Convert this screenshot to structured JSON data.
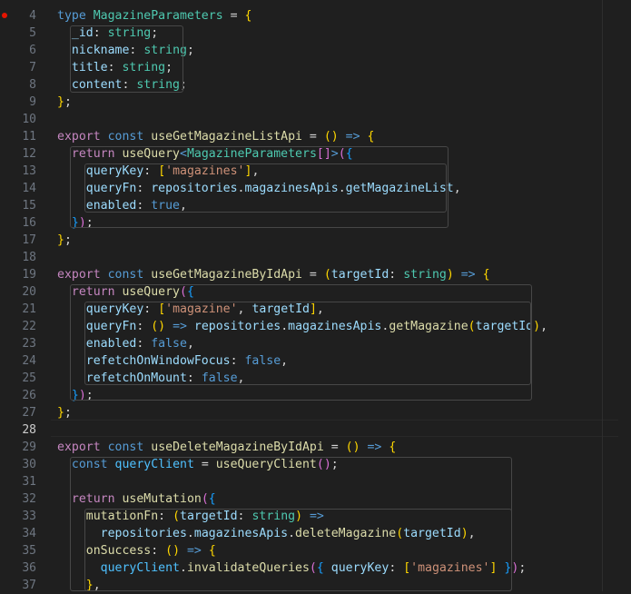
{
  "editor": {
    "language": "typescript",
    "active_line": "28",
    "breakpoint_line": "4",
    "colors": {
      "background": "#1f1f1f",
      "keyword": "#569cd6",
      "control_keyword": "#c586c0",
      "type": "#4ec9b0",
      "function": "#dcdcaa",
      "variable": "#9cdcfe",
      "constant": "#4fc1ff",
      "string": "#ce9178",
      "bracket_level_1": "#ffd700",
      "bracket_level_2": "#da70d6",
      "bracket_level_3": "#179fff",
      "breakpoint": "#e51400"
    }
  },
  "lines": [
    {
      "num": "4",
      "tokens": [
        [
          "type",
          "kw"
        ],
        [
          " ",
          "p"
        ],
        [
          "MagazineParameters",
          "type"
        ],
        [
          " = ",
          "p"
        ],
        [
          "{",
          "b1"
        ]
      ]
    },
    {
      "num": "5",
      "tokens": [
        [
          "  ",
          "p"
        ],
        [
          "_id",
          "var"
        ],
        [
          ": ",
          "p"
        ],
        [
          "string",
          "type"
        ],
        [
          ";",
          "p"
        ]
      ]
    },
    {
      "num": "6",
      "tokens": [
        [
          "  ",
          "p"
        ],
        [
          "nickname",
          "var"
        ],
        [
          ": ",
          "p"
        ],
        [
          "string",
          "type"
        ],
        [
          ";",
          "p"
        ]
      ]
    },
    {
      "num": "7",
      "tokens": [
        [
          "  ",
          "p"
        ],
        [
          "title",
          "var"
        ],
        [
          ": ",
          "p"
        ],
        [
          "string",
          "type"
        ],
        [
          ";",
          "p"
        ]
      ]
    },
    {
      "num": "8",
      "tokens": [
        [
          "  ",
          "p"
        ],
        [
          "content",
          "var"
        ],
        [
          ": ",
          "p"
        ],
        [
          "string",
          "type"
        ],
        [
          ";",
          "p"
        ]
      ]
    },
    {
      "num": "9",
      "tokens": [
        [
          "}",
          "b1"
        ],
        [
          ";",
          "p"
        ]
      ]
    },
    {
      "num": "10",
      "tokens": []
    },
    {
      "num": "11",
      "tokens": [
        [
          "export",
          "ctl"
        ],
        [
          " ",
          "p"
        ],
        [
          "const",
          "kw"
        ],
        [
          " ",
          "p"
        ],
        [
          "useGetMagazineListApi",
          "fn"
        ],
        [
          " = ",
          "p"
        ],
        [
          "()",
          "b1"
        ],
        [
          " ",
          "p"
        ],
        [
          "=>",
          "kw"
        ],
        [
          " ",
          "p"
        ],
        [
          "{",
          "b1"
        ]
      ]
    },
    {
      "num": "12",
      "tokens": [
        [
          "  ",
          "p"
        ],
        [
          "return",
          "ctl"
        ],
        [
          " ",
          "p"
        ],
        [
          "useQuery",
          "fn"
        ],
        [
          "<",
          "kw"
        ],
        [
          "MagazineParameters",
          "type"
        ],
        [
          "[]",
          "b2"
        ],
        [
          ">",
          "kw"
        ],
        [
          "(",
          "b2"
        ],
        [
          "{",
          "b3"
        ]
      ]
    },
    {
      "num": "13",
      "tokens": [
        [
          "    ",
          "p"
        ],
        [
          "queryKey",
          "var"
        ],
        [
          ": ",
          "p"
        ],
        [
          "[",
          "b1"
        ],
        [
          "'magazines'",
          "str"
        ],
        [
          "]",
          "b1"
        ],
        [
          ",",
          "p"
        ]
      ]
    },
    {
      "num": "14",
      "tokens": [
        [
          "    ",
          "p"
        ],
        [
          "queryFn",
          "var"
        ],
        [
          ": ",
          "p"
        ],
        [
          "repositories",
          "var"
        ],
        [
          ".",
          "p"
        ],
        [
          "magazinesApis",
          "var"
        ],
        [
          ".",
          "p"
        ],
        [
          "getMagazineList",
          "var"
        ],
        [
          ",",
          "p"
        ]
      ]
    },
    {
      "num": "15",
      "tokens": [
        [
          "    ",
          "p"
        ],
        [
          "enabled",
          "var"
        ],
        [
          ": ",
          "p"
        ],
        [
          "true",
          "kw"
        ],
        [
          ",",
          "p"
        ]
      ]
    },
    {
      "num": "16",
      "tokens": [
        [
          "  ",
          "p"
        ],
        [
          "}",
          "b3"
        ],
        [
          ")",
          "b2"
        ],
        [
          ";",
          "p"
        ]
      ]
    },
    {
      "num": "17",
      "tokens": [
        [
          "}",
          "b1"
        ],
        [
          ";",
          "p"
        ]
      ]
    },
    {
      "num": "18",
      "tokens": []
    },
    {
      "num": "19",
      "tokens": [
        [
          "export",
          "ctl"
        ],
        [
          " ",
          "p"
        ],
        [
          "const",
          "kw"
        ],
        [
          " ",
          "p"
        ],
        [
          "useGetMagazineByIdApi",
          "fn"
        ],
        [
          " = ",
          "p"
        ],
        [
          "(",
          "b1"
        ],
        [
          "targetId",
          "var"
        ],
        [
          ": ",
          "p"
        ],
        [
          "string",
          "type"
        ],
        [
          ")",
          "b1"
        ],
        [
          " ",
          "p"
        ],
        [
          "=>",
          "kw"
        ],
        [
          " ",
          "p"
        ],
        [
          "{",
          "b1"
        ]
      ]
    },
    {
      "num": "20",
      "tokens": [
        [
          "  ",
          "p"
        ],
        [
          "return",
          "ctl"
        ],
        [
          " ",
          "p"
        ],
        [
          "useQuery",
          "fn"
        ],
        [
          "(",
          "b2"
        ],
        [
          "{",
          "b3"
        ]
      ]
    },
    {
      "num": "21",
      "tokens": [
        [
          "    ",
          "p"
        ],
        [
          "queryKey",
          "var"
        ],
        [
          ": ",
          "p"
        ],
        [
          "[",
          "b1"
        ],
        [
          "'magazine'",
          "str"
        ],
        [
          ", ",
          "p"
        ],
        [
          "targetId",
          "var"
        ],
        [
          "]",
          "b1"
        ],
        [
          ",",
          "p"
        ]
      ]
    },
    {
      "num": "22",
      "tokens": [
        [
          "    ",
          "p"
        ],
        [
          "queryFn",
          "var"
        ],
        [
          ": ",
          "p"
        ],
        [
          "()",
          "b1"
        ],
        [
          " ",
          "p"
        ],
        [
          "=>",
          "kw"
        ],
        [
          " ",
          "p"
        ],
        [
          "repositories",
          "var"
        ],
        [
          ".",
          "p"
        ],
        [
          "magazinesApis",
          "var"
        ],
        [
          ".",
          "p"
        ],
        [
          "getMagazine",
          "fn"
        ],
        [
          "(",
          "b1"
        ],
        [
          "targetId",
          "var"
        ],
        [
          ")",
          "b1"
        ],
        [
          ",",
          "p"
        ]
      ]
    },
    {
      "num": "23",
      "tokens": [
        [
          "    ",
          "p"
        ],
        [
          "enabled",
          "var"
        ],
        [
          ": ",
          "p"
        ],
        [
          "false",
          "kw"
        ],
        [
          ",",
          "p"
        ]
      ]
    },
    {
      "num": "24",
      "tokens": [
        [
          "    ",
          "p"
        ],
        [
          "refetchOnWindowFocus",
          "var"
        ],
        [
          ": ",
          "p"
        ],
        [
          "false",
          "kw"
        ],
        [
          ",",
          "p"
        ]
      ]
    },
    {
      "num": "25",
      "tokens": [
        [
          "    ",
          "p"
        ],
        [
          "refetchOnMount",
          "var"
        ],
        [
          ": ",
          "p"
        ],
        [
          "false",
          "kw"
        ],
        [
          ",",
          "p"
        ]
      ]
    },
    {
      "num": "26",
      "tokens": [
        [
          "  ",
          "p"
        ],
        [
          "}",
          "b3"
        ],
        [
          ")",
          "b2"
        ],
        [
          ";",
          "p"
        ]
      ]
    },
    {
      "num": "27",
      "tokens": [
        [
          "}",
          "b1"
        ],
        [
          ";",
          "p"
        ]
      ]
    },
    {
      "num": "28",
      "tokens": []
    },
    {
      "num": "29",
      "tokens": [
        [
          "export",
          "ctl"
        ],
        [
          " ",
          "p"
        ],
        [
          "const",
          "kw"
        ],
        [
          " ",
          "p"
        ],
        [
          "useDeleteMagazineByIdApi",
          "fn"
        ],
        [
          " = ",
          "p"
        ],
        [
          "()",
          "b1"
        ],
        [
          " ",
          "p"
        ],
        [
          "=>",
          "kw"
        ],
        [
          " ",
          "p"
        ],
        [
          "{",
          "b1"
        ]
      ]
    },
    {
      "num": "30",
      "tokens": [
        [
          "  ",
          "p"
        ],
        [
          "const",
          "kw"
        ],
        [
          " ",
          "p"
        ],
        [
          "queryClient",
          "const"
        ],
        [
          " = ",
          "p"
        ],
        [
          "useQueryClient",
          "fn"
        ],
        [
          "()",
          "b2"
        ],
        [
          ";",
          "p"
        ]
      ]
    },
    {
      "num": "31",
      "tokens": []
    },
    {
      "num": "32",
      "tokens": [
        [
          "  ",
          "p"
        ],
        [
          "return",
          "ctl"
        ],
        [
          " ",
          "p"
        ],
        [
          "useMutation",
          "fn"
        ],
        [
          "(",
          "b2"
        ],
        [
          "{",
          "b3"
        ]
      ]
    },
    {
      "num": "33",
      "tokens": [
        [
          "    ",
          "p"
        ],
        [
          "mutationFn",
          "fn"
        ],
        [
          ": ",
          "p"
        ],
        [
          "(",
          "b1"
        ],
        [
          "targetId",
          "var"
        ],
        [
          ": ",
          "p"
        ],
        [
          "string",
          "type"
        ],
        [
          ")",
          "b1"
        ],
        [
          " ",
          "p"
        ],
        [
          "=>",
          "kw"
        ]
      ]
    },
    {
      "num": "34",
      "tokens": [
        [
          "      ",
          "p"
        ],
        [
          "repositories",
          "var"
        ],
        [
          ".",
          "p"
        ],
        [
          "magazinesApis",
          "var"
        ],
        [
          ".",
          "p"
        ],
        [
          "deleteMagazine",
          "fn"
        ],
        [
          "(",
          "b1"
        ],
        [
          "targetId",
          "var"
        ],
        [
          ")",
          "b1"
        ],
        [
          ",",
          "p"
        ]
      ]
    },
    {
      "num": "35",
      "tokens": [
        [
          "    ",
          "p"
        ],
        [
          "onSuccess",
          "fn"
        ],
        [
          ": ",
          "p"
        ],
        [
          "()",
          "b1"
        ],
        [
          " ",
          "p"
        ],
        [
          "=>",
          "kw"
        ],
        [
          " ",
          "p"
        ],
        [
          "{",
          "b1"
        ]
      ]
    },
    {
      "num": "36",
      "tokens": [
        [
          "      ",
          "p"
        ],
        [
          "queryClient",
          "const"
        ],
        [
          ".",
          "p"
        ],
        [
          "invalidateQueries",
          "fn"
        ],
        [
          "(",
          "b2"
        ],
        [
          "{",
          "b3"
        ],
        [
          " ",
          "p"
        ],
        [
          "queryKey",
          "var"
        ],
        [
          ": ",
          "p"
        ],
        [
          "[",
          "b1"
        ],
        [
          "'magazines'",
          "str"
        ],
        [
          "]",
          "b1"
        ],
        [
          " ",
          "p"
        ],
        [
          "}",
          "b3"
        ],
        [
          ")",
          "b2"
        ],
        [
          ";",
          "p"
        ]
      ]
    },
    {
      "num": "37",
      "tokens": [
        [
          "    ",
          "p"
        ],
        [
          "}",
          "b1"
        ],
        [
          ",",
          "p"
        ]
      ]
    }
  ]
}
